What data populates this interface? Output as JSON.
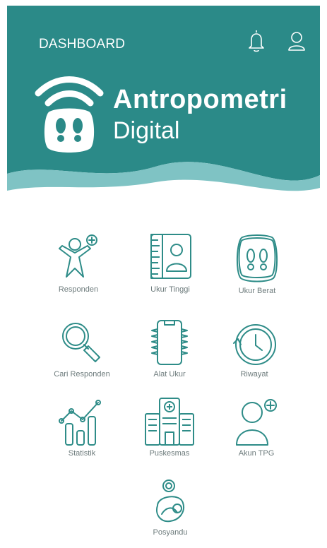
{
  "header": {
    "title": "DASHBOARD",
    "notification_icon": "bell-icon",
    "profile_icon": "user-icon",
    "colors": {
      "primary": "#2b8a88",
      "wave": "#7fc3c4",
      "accent": "#2e8c88"
    }
  },
  "brand": {
    "line1": "Antropometri",
    "line2": "Digital",
    "icon": "scale-wifi-logo"
  },
  "menu": [
    {
      "label": "Responden",
      "icon": "add-person-icon"
    },
    {
      "label": "Ukur Tinggi",
      "icon": "height-ruler-id-icon"
    },
    {
      "label": "Ukur Berat",
      "icon": "scale-icon"
    },
    {
      "label": "Cari Responden",
      "icon": "search-icon"
    },
    {
      "label": "Alat Ukur",
      "icon": "device-chip-icon"
    },
    {
      "label": "Riwayat",
      "icon": "history-clock-icon"
    },
    {
      "label": "Statistik",
      "icon": "chart-icon"
    },
    {
      "label": "Puskesmas",
      "icon": "hospital-icon"
    },
    {
      "label": "Akun TPG",
      "icon": "add-account-icon"
    },
    {
      "label": "Posyandu",
      "icon": "mother-child-icon"
    }
  ]
}
